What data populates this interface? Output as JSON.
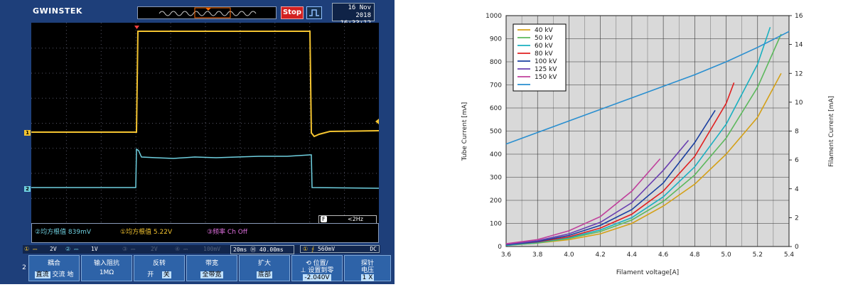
{
  "scope": {
    "brand": "GWINSTEK",
    "stop_label": "Stop",
    "date": "16 Nov 2018",
    "time": "16:33:12",
    "ch1_marker": "1",
    "ch2_marker": "2",
    "colors": {
      "ch1": "#f4c430",
      "ch2": "#6fd0e0",
      "math": "#e070e0",
      "bg": "#1e3f7a"
    },
    "trig_badge": "F",
    "trig_freq": "<2Hz",
    "measurements": [
      {
        "label": "②均方根值 839mV",
        "color": "#6fd0e0"
      },
      {
        "label": "①均方根值 5.22V",
        "color": "#f4c430"
      },
      {
        "label": "③频率 Ch Off",
        "color": "#e070e0"
      }
    ],
    "status": {
      "ch1_scale": "2V",
      "ch2_scale": "1V",
      "ch3_scale": "2V",
      "ch4_scale": "100mV",
      "timebase": "20ms",
      "h_pos": "40.00ms",
      "trig_level": "560mV",
      "coupling": "DC"
    },
    "menu": {
      "channel_num": "2",
      "buttons": [
        {
          "title": "耦合",
          "opts": [
            "直流",
            "交流",
            "地"
          ],
          "selected": 0
        },
        {
          "title": "输入阻抗",
          "opts": [
            "1MΩ"
          ],
          "selected": -1
        },
        {
          "title": "反转",
          "opts": [
            "开",
            "关"
          ],
          "selected": 1
        },
        {
          "title": "带宽",
          "opts": [
            "全带宽"
          ],
          "selected": 0
        },
        {
          "title": "扩大",
          "opts": [
            "底部"
          ],
          "selected": 0
        },
        {
          "title": "⟲ 位置/",
          "opts": [
            "⊥ 设置到零",
            "-2.040V"
          ],
          "selected": 1
        },
        {
          "title": "探针",
          "opts": [
            "电压",
            "1 X"
          ],
          "selected": 1
        }
      ]
    }
  },
  "chart_data": {
    "type": "line",
    "xlabel": "Filament voltage[A]",
    "ylabel": "Tube Current [mA]",
    "y2label": "Filament Current [mA]",
    "xlim": [
      3.6,
      5.4
    ],
    "ylim": [
      0,
      1000
    ],
    "y2lim": [
      0,
      16
    ],
    "xticks": [
      "3.6",
      "3.8",
      "4.0",
      "4.2",
      "4.4",
      "4.6",
      "4.8",
      "5.0",
      "5.2",
      "5.4"
    ],
    "yticks": [
      "0",
      "100",
      "200",
      "300",
      "400",
      "500",
      "600",
      "700",
      "800",
      "900",
      "1000"
    ],
    "y2ticks": [
      "0",
      "2",
      "4",
      "6",
      "8",
      "10",
      "12",
      "14",
      "16"
    ],
    "grid": true,
    "legend_position": "top-left",
    "series": [
      {
        "name": "40 kV",
        "color": "#d4a017",
        "x": [
          3.6,
          3.8,
          4.0,
          4.2,
          4.4,
          4.6,
          4.8,
          5.0,
          5.2,
          5.35
        ],
        "y": [
          5,
          15,
          30,
          55,
          100,
          175,
          270,
          400,
          560,
          750
        ]
      },
      {
        "name": "50 kV",
        "color": "#5cb85c",
        "x": [
          3.6,
          3.8,
          4.0,
          4.2,
          4.4,
          4.6,
          4.8,
          5.0,
          5.2,
          5.35
        ],
        "y": [
          5,
          15,
          35,
          65,
          115,
          195,
          310,
          470,
          690,
          920
        ]
      },
      {
        "name": "60 kV",
        "color": "#1ab0c0",
        "x": [
          3.6,
          3.8,
          4.0,
          4.2,
          4.4,
          4.6,
          4.8,
          5.0,
          5.2,
          5.28
        ],
        "y": [
          5,
          18,
          38,
          72,
          125,
          215,
          345,
          530,
          790,
          950
        ]
      },
      {
        "name": "80 kV",
        "color": "#e02020",
        "x": [
          3.6,
          3.8,
          4.0,
          4.2,
          4.4,
          4.6,
          4.8,
          5.0,
          5.05
        ],
        "y": [
          8,
          20,
          42,
          80,
          140,
          240,
          390,
          620,
          710
        ]
      },
      {
        "name": "100 kV",
        "color": "#1a3fa0",
        "x": [
          3.6,
          3.8,
          4.0,
          4.2,
          4.4,
          4.6,
          4.8,
          4.93
        ],
        "y": [
          8,
          22,
          48,
          92,
          160,
          275,
          450,
          590
        ]
      },
      {
        "name": "125 kV",
        "color": "#6a3fb0",
        "x": [
          3.6,
          3.8,
          4.0,
          4.2,
          4.4,
          4.6,
          4.76
        ],
        "y": [
          10,
          25,
          55,
          105,
          190,
          330,
          460
        ]
      },
      {
        "name": "150 kV",
        "color": "#c0409c",
        "x": [
          3.6,
          3.8,
          4.0,
          4.2,
          4.4,
          4.58
        ],
        "y": [
          12,
          30,
          68,
          130,
          240,
          380
        ]
      },
      {
        "name": "",
        "color": "#2a8fd0",
        "axis": "y2",
        "x": [
          3.6,
          3.8,
          4.0,
          4.2,
          4.4,
          4.6,
          4.8,
          5.0,
          5.2,
          5.4
        ],
        "y": [
          7.1,
          7.9,
          8.7,
          9.5,
          10.3,
          11.1,
          11.9,
          12.8,
          13.8,
          14.9
        ]
      }
    ]
  }
}
